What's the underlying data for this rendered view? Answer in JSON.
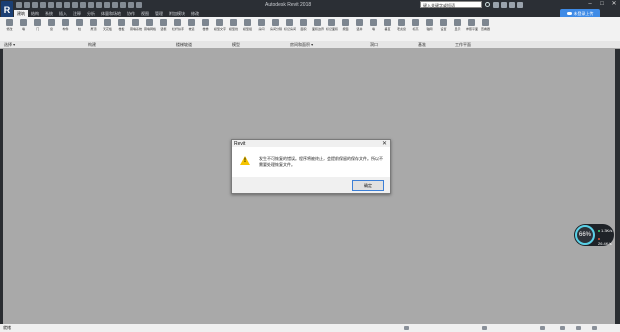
{
  "app": {
    "title": "Autodesk Revit 2018",
    "logo_letter": "R"
  },
  "search": {
    "text": "键入关键字或短语"
  },
  "ribbon_tabs": [
    "建筑",
    "结构",
    "系统",
    "插入",
    "注释",
    "分析",
    "体量和场地",
    "协作",
    "视图",
    "管理",
    "附加模块",
    "修改"
  ],
  "cloud_button": {
    "label": "未登录上传"
  },
  "ribbon_buttons": [
    {
      "label": "修改"
    },
    {
      "label": "墙"
    },
    {
      "label": "门"
    },
    {
      "label": "窗"
    },
    {
      "label": "构件"
    },
    {
      "label": "柱"
    },
    {
      "label": "屋顶"
    },
    {
      "label": "天花板"
    },
    {
      "label": "楼板"
    },
    {
      "label": "幕墙系统"
    },
    {
      "label": "幕墙网格"
    },
    {
      "label": "竖梃"
    },
    {
      "label": "栏杆扶手"
    },
    {
      "label": "坡道"
    },
    {
      "label": "楼梯"
    },
    {
      "label": "模型文字"
    },
    {
      "label": "模型线"
    },
    {
      "label": "模型组"
    },
    {
      "label": "房间"
    },
    {
      "label": "房间分隔"
    },
    {
      "label": "标记房间"
    },
    {
      "label": "面积"
    },
    {
      "label": "面积边界"
    },
    {
      "label": "标记面积"
    },
    {
      "label": "按面"
    },
    {
      "label": "竖井"
    },
    {
      "label": "墙"
    },
    {
      "label": "垂直"
    },
    {
      "label": "老虎窗"
    },
    {
      "label": "标高"
    },
    {
      "label": "轴网"
    },
    {
      "label": "设置"
    },
    {
      "label": "显示"
    },
    {
      "label": "参照平面"
    },
    {
      "label": "查看器"
    }
  ],
  "panels": [
    {
      "label": "选择 ▾"
    },
    {
      "label": "构建"
    },
    {
      "label": "楼梯坡道"
    },
    {
      "label": "模型"
    },
    {
      "label": "房间和面积 ▾"
    },
    {
      "label": "洞口"
    },
    {
      "label": "基准"
    },
    {
      "label": "工作平面"
    }
  ],
  "dialog": {
    "title": "Revit",
    "close": "✕",
    "message": "发生不可恢复的错误。程序将被终止，会提前保留的保存文件。所以不需要处理恢复文件。",
    "ok_label": "确定"
  },
  "status": {
    "text": "就绪"
  },
  "gauge": {
    "percent": "66%",
    "upload": "1.3K/s",
    "download": "26.4K/s"
  },
  "colors": {
    "accent": "#3f8be6",
    "warning": "#f5c400",
    "canvas": "#a9a9a9"
  }
}
